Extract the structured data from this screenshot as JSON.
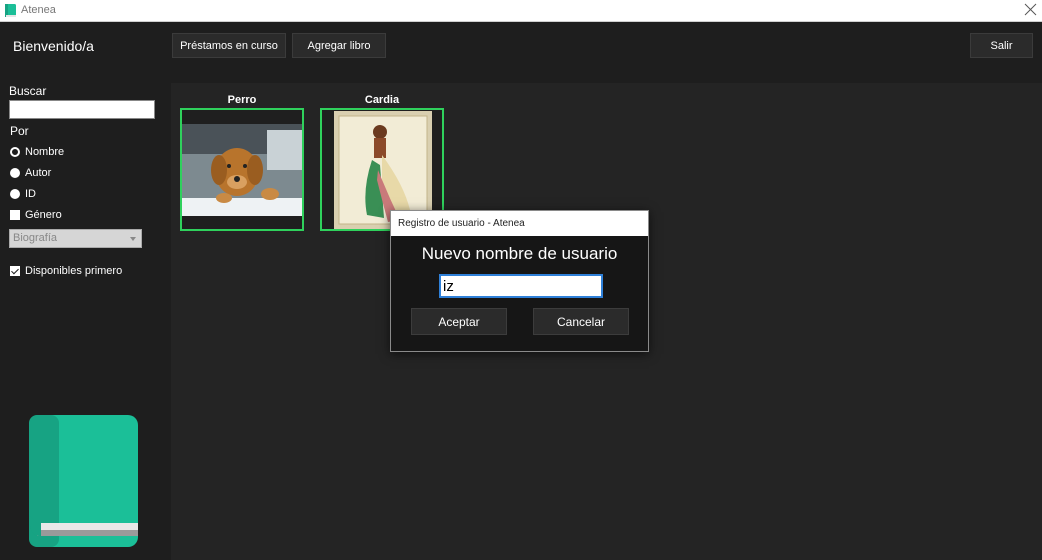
{
  "window": {
    "title": "Atenea"
  },
  "sidebar": {
    "welcome": "Bienvenido/a",
    "search_label": "Buscar",
    "search_value": "",
    "by_label": "Por",
    "options": [
      {
        "label": "Nombre",
        "selected": true
      },
      {
        "label": "Autor",
        "selected": false
      },
      {
        "label": "ID",
        "selected": false
      }
    ],
    "genre_label": "Género",
    "genre_value": "Biografía",
    "available_first_label": "Disponibles primero"
  },
  "toolbar": {
    "loans_label": "Préstamos en curso",
    "add_book_label": "Agregar libro",
    "exit_label": "Salir"
  },
  "books": [
    {
      "title": "Perro"
    },
    {
      "title": "Cardia"
    }
  ],
  "dialog": {
    "title": "Registro de usuario - Atenea",
    "heading": "Nuevo nombre de usuario",
    "username_value": "iz",
    "accept_label": "Aceptar",
    "cancel_label": "Cancelar"
  },
  "colors": {
    "accent": "#2fd15c",
    "logo_green": "#1bbf98",
    "background": "#1e1e1e",
    "input_focus": "#2f80d8"
  }
}
